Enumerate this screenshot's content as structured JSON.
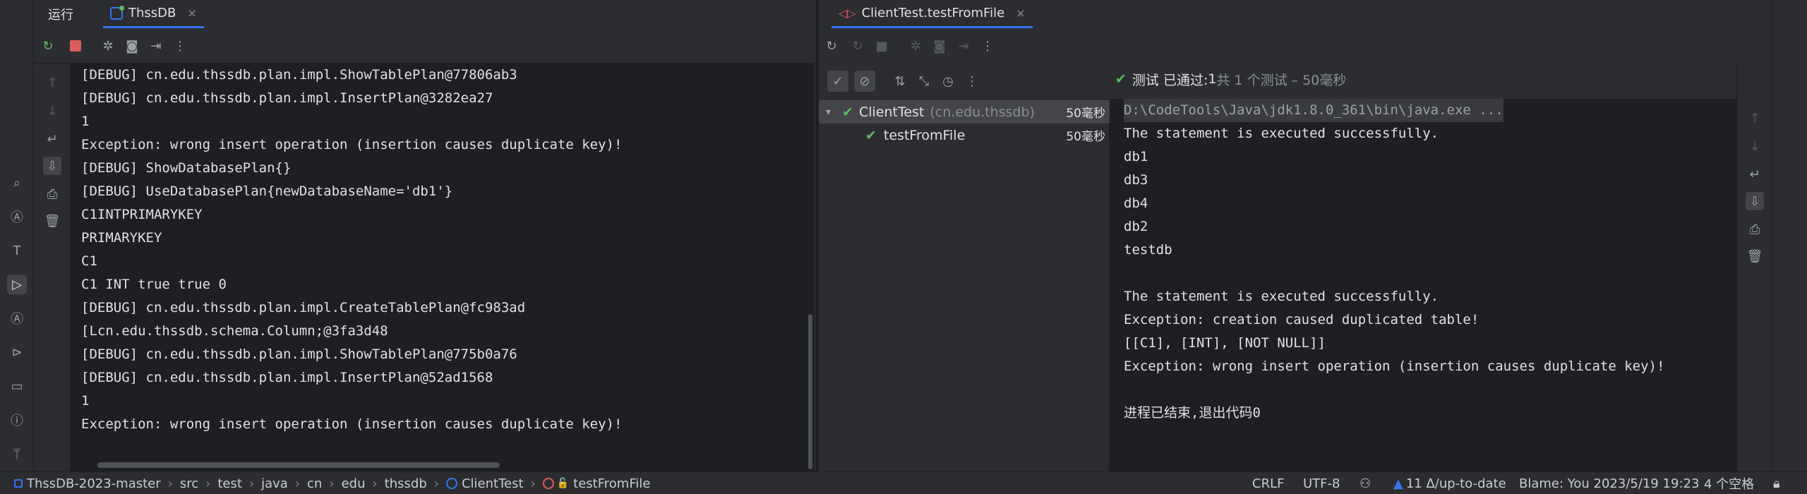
{
  "run_panel": {
    "tabs": [
      {
        "label": "运行"
      },
      {
        "label": "ThssDB",
        "close": "×"
      }
    ],
    "console_lines": [
      "[DEBUG] cn.edu.thssdb.plan.impl.ShowTablePlan@77806ab3",
      "[DEBUG] cn.edu.thssdb.plan.impl.InsertPlan@3282ea27",
      "1",
      "Exception: wrong insert operation (insertion causes duplicate key)!",
      "[DEBUG] ShowDatabasePlan{}",
      "[DEBUG] UseDatabasePlan{newDatabaseName='db1'}",
      "C1INTPRIMARYKEY",
      "PRIMARYKEY",
      "C1",
      "C1 INT true true 0",
      "[DEBUG] cn.edu.thssdb.plan.impl.CreateTablePlan@fc983ad",
      "[Lcn.edu.thssdb.schema.Column;@3fa3d48",
      "[DEBUG] cn.edu.thssdb.plan.impl.ShowTablePlan@775b0a76",
      "[DEBUG] cn.edu.thssdb.plan.impl.InsertPlan@52ad1568",
      "1",
      "Exception: wrong insert operation (insertion causes duplicate key)!"
    ]
  },
  "test_panel": {
    "tab": {
      "label": "ClientTest.testFromFile",
      "close": "×"
    },
    "status": {
      "prefix": "测试 已通过: ",
      "count": "1",
      "suffix": "共 1 个测试 – 50毫秒"
    },
    "tree": [
      {
        "label": "ClientTest",
        "package": "(cn.edu.thssdb)",
        "duration": "50毫秒"
      },
      {
        "label": "testFromFile",
        "duration": "50毫秒"
      }
    ],
    "console_lines": [
      "D:\\CodeTools\\Java\\jdk1.8.0_361\\bin\\java.exe ...",
      "The statement is executed successfully.",
      "db1",
      "db3",
      "db4",
      "db2",
      "testdb",
      "",
      "The statement is executed successfully.",
      "Exception: creation caused duplicated table!",
      "[[C1], [INT], [NOT NULL]]",
      "Exception: wrong insert operation (insertion causes duplicate key)!",
      "",
      "进程已结束,退出代码0"
    ]
  },
  "statusbar": {
    "breadcrumbs": [
      "ThssDB-2023-master",
      "src",
      "test",
      "java",
      "cn",
      "edu",
      "thssdb",
      "ClientTest",
      "testFromFile"
    ],
    "line_ending": "CRLF",
    "encoding": "UTF-8",
    "vcs": "11 Δ/up-to-date",
    "blame": "Blame: You 2023/5/19 19:23",
    "indent": "4 个空格"
  },
  "colors": {
    "accent": "#3574f0",
    "success": "#5fb865",
    "stop": "#db5c5c"
  }
}
